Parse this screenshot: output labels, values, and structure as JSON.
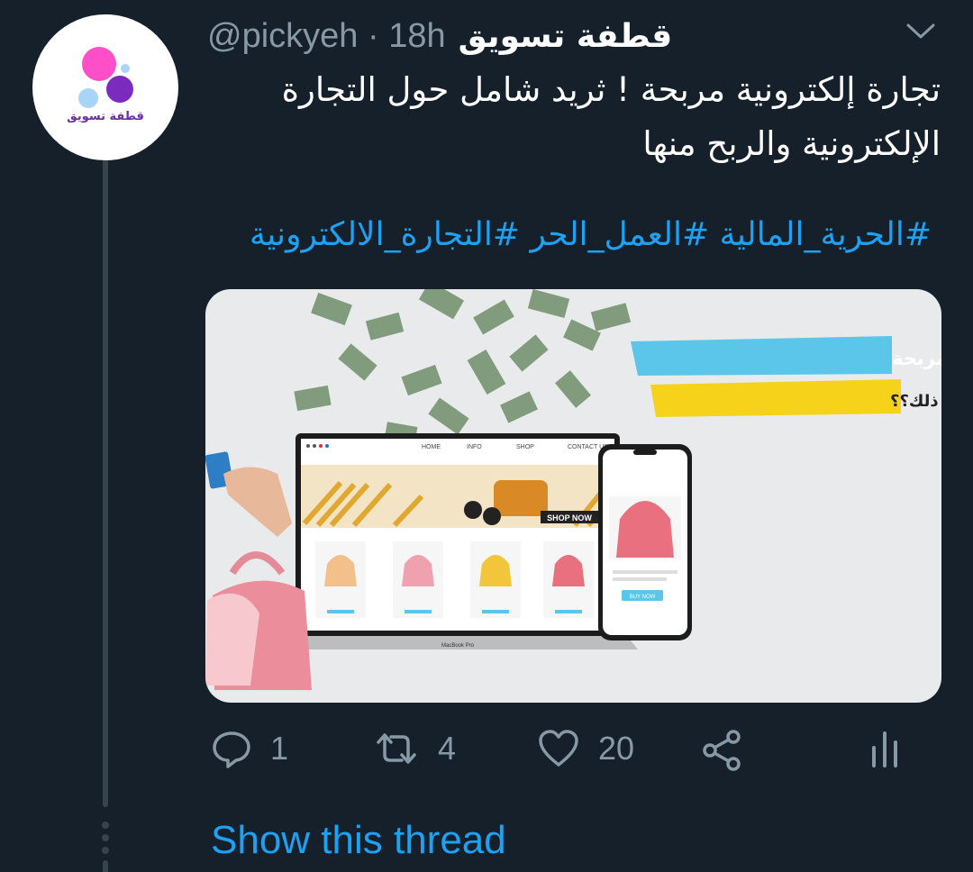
{
  "tweet": {
    "display_name": "قطفة تسويق",
    "handle": "@pickyeh",
    "separator": "·",
    "time": "18h",
    "text_line1": "تجارة إلكترونية مربحة ! ثريد شامل حول التجارة",
    "text_line2": "الإلكترونية والربح منها",
    "hashtags": "#الحرية_المالية #العمل_الحر #التجارة_الالكترونية"
  },
  "avatar": {
    "logo_text": "قطفة تسويق",
    "colors": {
      "pink": "#ff4fc8",
      "light_blue": "#a8d4f5",
      "purple": "#7b2cbf"
    }
  },
  "media": {
    "banner_title": "تجاره إلكترونية مربحة",
    "banner_subtitle": "كيف يمكن تحقيق ذلك؟؟",
    "nav_items": [
      "HOME",
      "INFO",
      "SHOP",
      "CONTACT US"
    ],
    "shop_now": "SHOP NOW",
    "buy_now": "BUY NOW",
    "laptop_label": "MacBook Pro"
  },
  "actions": {
    "replies": "1",
    "retweets": "4",
    "likes": "20"
  },
  "show_thread": "Show this thread",
  "colors": {
    "accent": "#1da1f2",
    "muted": "#8899a6",
    "bg": "#15202b"
  }
}
